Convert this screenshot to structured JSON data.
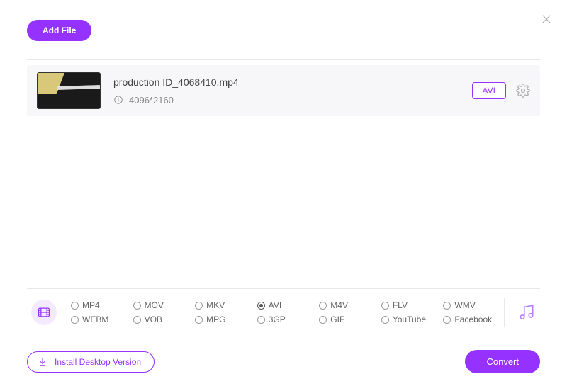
{
  "header": {
    "add_file_label": "Add File"
  },
  "file": {
    "name": "production ID_4068410.mp4",
    "resolution": "4096*2160",
    "format_badge": "AVI"
  },
  "formats": {
    "row1": [
      "MP4",
      "MOV",
      "MKV",
      "AVI",
      "M4V",
      "FLV",
      "WMV"
    ],
    "row2": [
      "WEBM",
      "VOB",
      "MPG",
      "3GP",
      "GIF",
      "YouTube",
      "Facebook"
    ],
    "selected": "AVI"
  },
  "footer": {
    "install_label": "Install Desktop Version",
    "convert_label": "Convert"
  }
}
